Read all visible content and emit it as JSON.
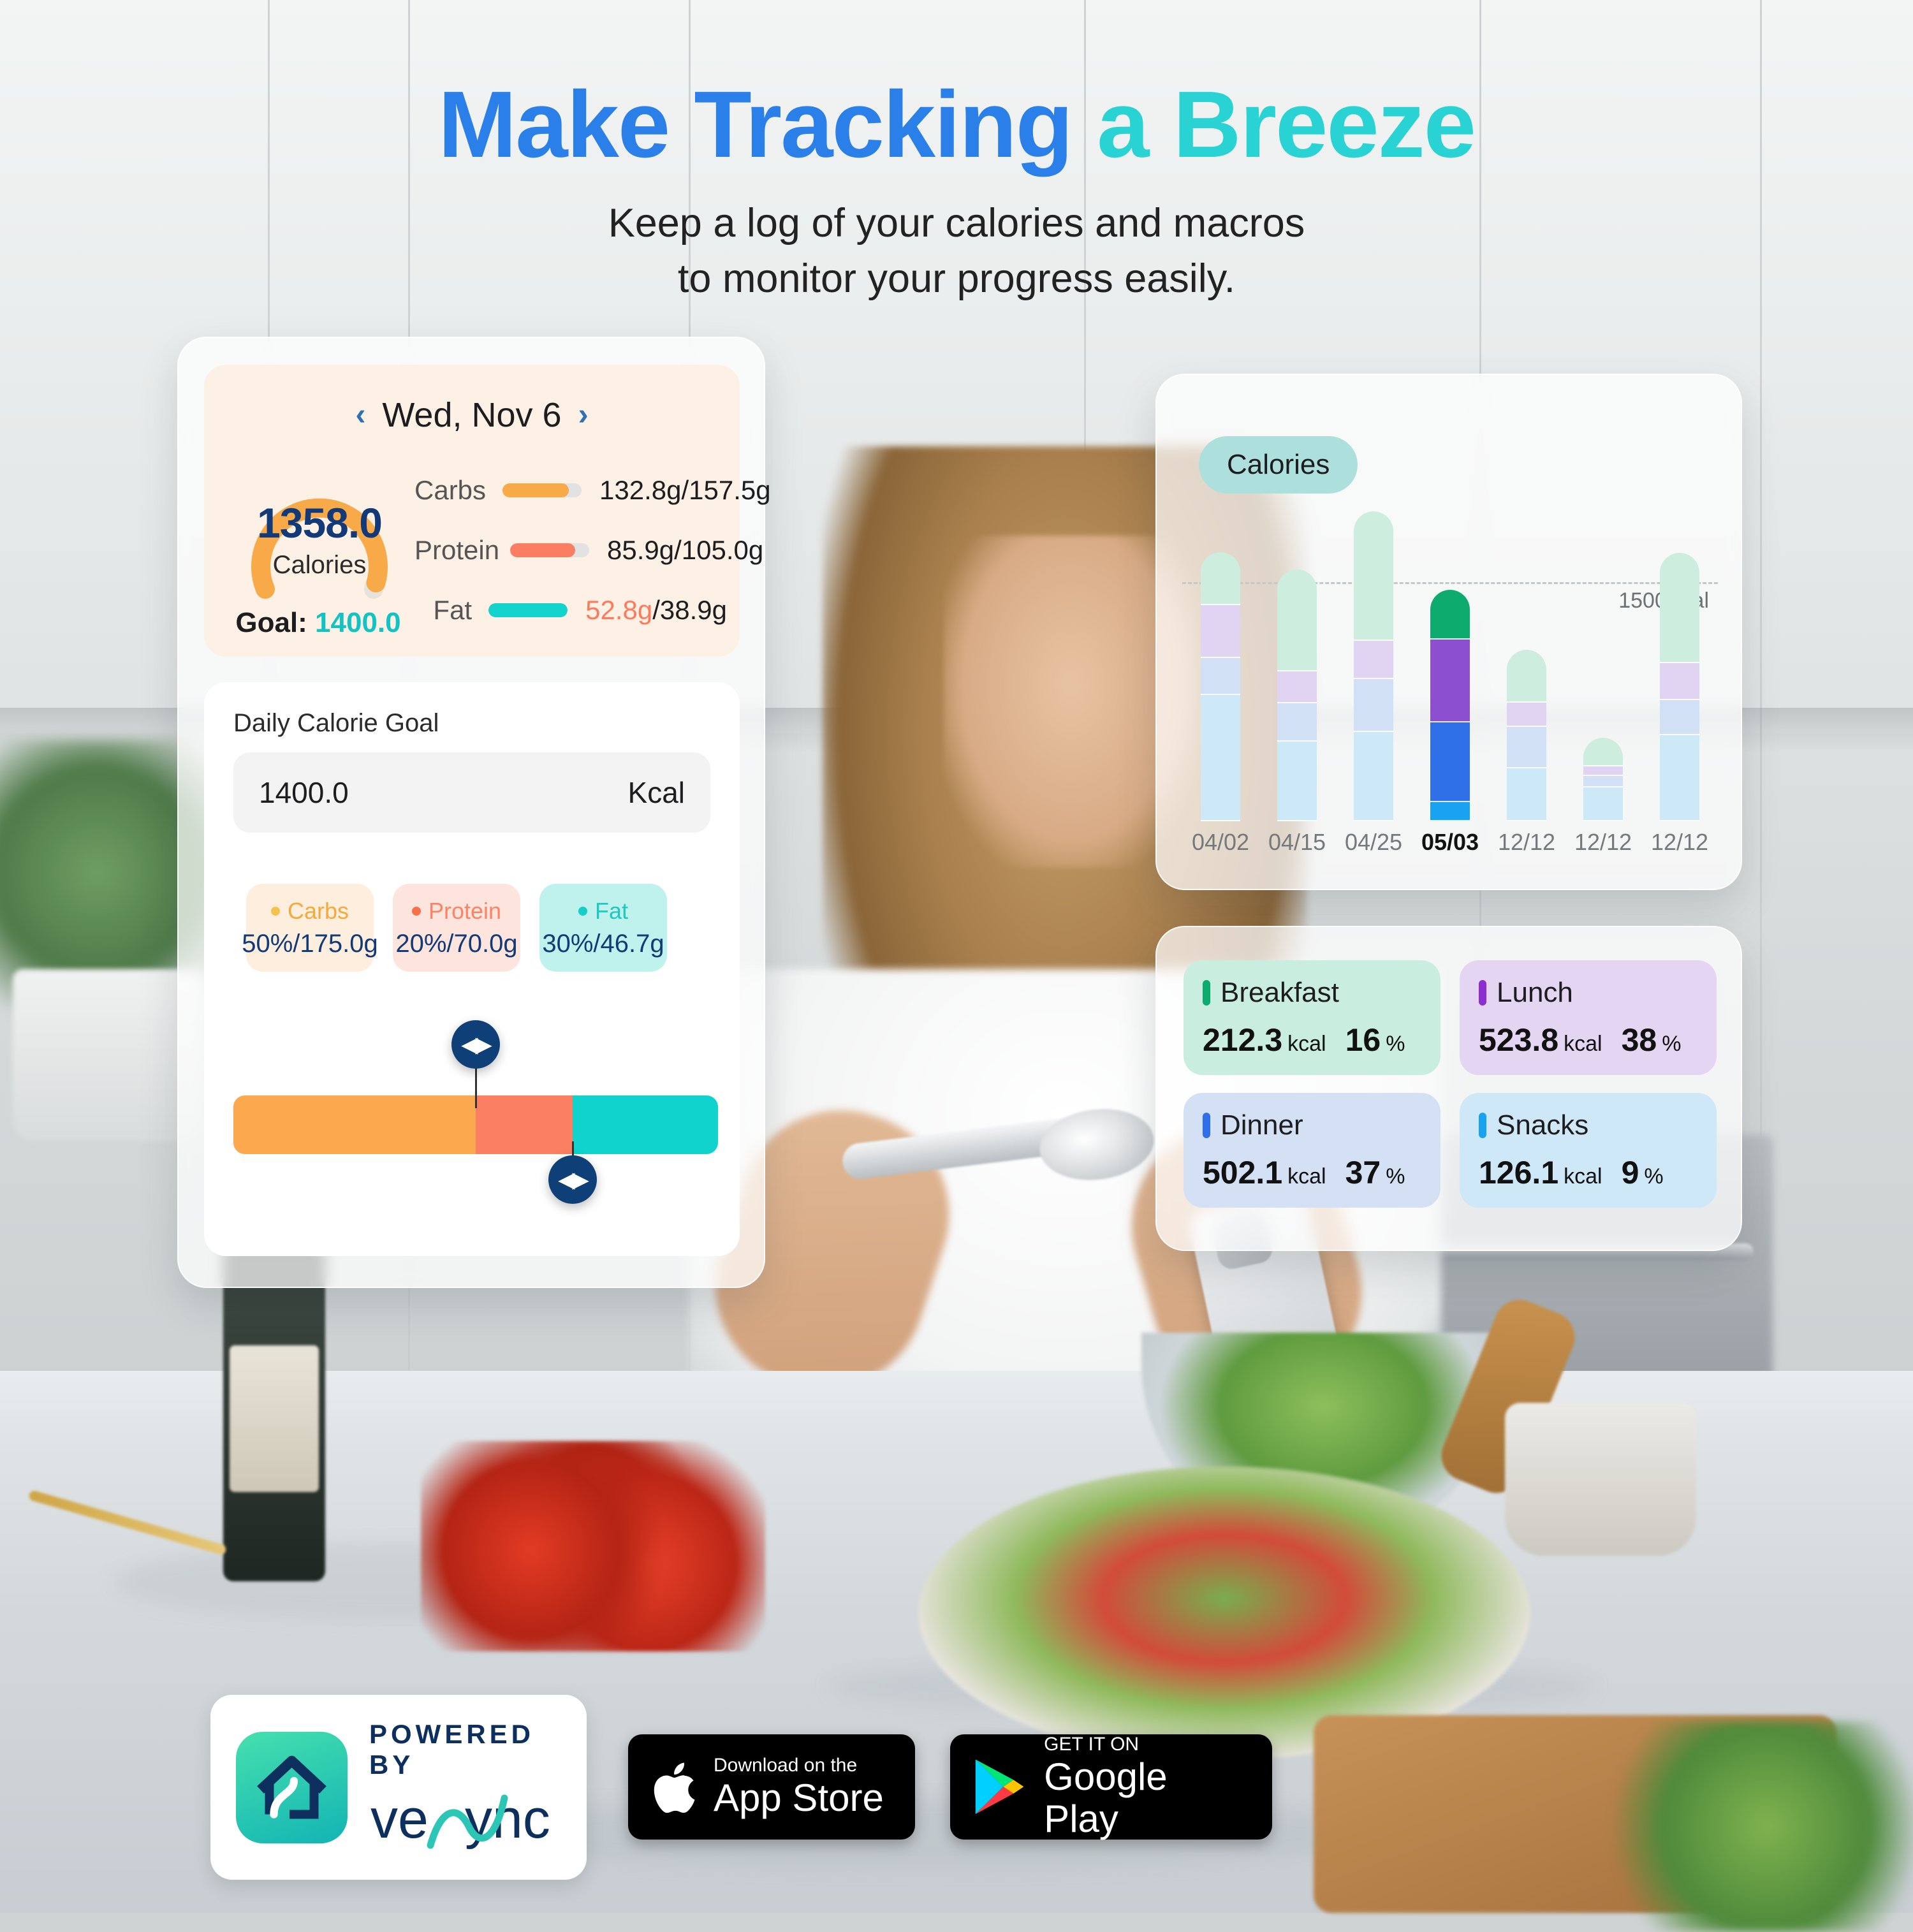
{
  "headline": {
    "title_part1": "Make Tracking ",
    "title_part2": "a Breeze",
    "sub_line1": "Keep a log of your calories and macros",
    "sub_line2": "to monitor your progress easily.",
    "color_part1": "#2b7fe8",
    "color_part2": "#2ad3d3"
  },
  "summary": {
    "prev_arrow": "‹",
    "next_arrow": "›",
    "date": "Wed, Nov 6",
    "calories_value": "1358.0",
    "calories_label": "Calories",
    "goal_prefix": "Goal: ",
    "goal_value": "1400.0",
    "gauge_percent": 97,
    "macros": [
      {
        "name": "Carbs",
        "value": "132.8g/157.5g",
        "color": "#f8a948",
        "fill_pct": 84,
        "over": false,
        "over_text": ""
      },
      {
        "name": "Protein",
        "value": "85.9g/105.0g",
        "color": "#fa7f62",
        "fill_pct": 82,
        "over": false,
        "over_text": ""
      },
      {
        "name": "Fat",
        "value": "/38.9g",
        "color": "#12d4cc",
        "fill_pct": 100,
        "over": true,
        "over_text": "52.8g"
      }
    ]
  },
  "daily_goal": {
    "title": "Daily Calorie Goal",
    "input_value": "1400.0",
    "input_unit": "Kcal",
    "macro_cards": [
      {
        "name": "Carbs",
        "value": "50%/175.0g",
        "bg": "#fdeedd",
        "fg": "#f6a93b",
        "dot": "#f6c24b"
      },
      {
        "name": "Protein",
        "value": "20%/70.0g",
        "bg": "#fde4dc",
        "fg": "#fa8465",
        "dot": "#fa7049"
      },
      {
        "name": "Fat",
        "value": "30%/46.7g",
        "bg": "#bff2ec",
        "fg": "#1fc9c0",
        "dot": "#14cfc6"
      }
    ],
    "slider": {
      "segments": [
        {
          "name": "Carbs",
          "pct": 50,
          "color": "#fba84f"
        },
        {
          "name": "Protein",
          "pct": 20,
          "color": "#fb7f62"
        },
        {
          "name": "Fat",
          "pct": 30,
          "color": "#0fd3cc"
        }
      ],
      "knob_glyph": "◀▶",
      "knob1_pct": 50,
      "knob2_pct": 70
    }
  },
  "chart_data": {
    "type": "bar",
    "title": "Calories",
    "xlabel": "",
    "ylabel": "",
    "ylim": [
      0,
      2000
    ],
    "grid": false,
    "legend_position": "none",
    "goal_line": {
      "value": 1500,
      "label": "1500Kcal",
      "style": "dashed"
    },
    "categories": [
      "04/02",
      "04/15",
      "04/25",
      "05/03",
      "12/12",
      "12/12",
      "12/12"
    ],
    "active_category": "05/03",
    "series": [
      {
        "name": "Breakfast",
        "color_active": "#0eab6e",
        "color_dim": "#cdeede",
        "values": [
          330,
          640,
          810,
          310,
          330,
          180,
          690
        ]
      },
      {
        "name": "Lunch",
        "color_active": "#8b4fd0",
        "color_dim": "#e0d4f2",
        "values": [
          330,
          200,
          240,
          520,
          150,
          60,
          230
        ]
      },
      {
        "name": "Dinner",
        "color_active": "#2f6fe8",
        "color_dim": "#d2e0f5",
        "values": [
          230,
          240,
          330,
          500,
          260,
          70,
          220
        ]
      },
      {
        "name": "Snacks",
        "color_active": "#19a2ef",
        "color_dim": "#cde9f8",
        "values": [
          790,
          500,
          560,
          120,
          330,
          210,
          540
        ]
      }
    ],
    "totals": [
      1680,
      1580,
      1940,
      1450,
      1070,
      520,
      1680
    ]
  },
  "meals": [
    {
      "name": "Breakfast",
      "kcal": "212.3",
      "kcal_unit": "kcal",
      "pct": "16",
      "pct_unit": "%",
      "bg": "#c9eedf",
      "tick": "#0eab6e"
    },
    {
      "name": "Lunch",
      "kcal": "523.8",
      "kcal_unit": "kcal",
      "pct": "38",
      "pct_unit": "%",
      "bg": "#e4d5f2",
      "tick": "#8b2fd0"
    },
    {
      "name": "Dinner",
      "kcal": "502.1",
      "kcal_unit": "kcal",
      "pct": "37",
      "pct_unit": "%",
      "bg": "#d4e0f4",
      "tick": "#2f6fe8"
    },
    {
      "name": "Snacks",
      "kcal": "126.1",
      "kcal_unit": "kcal",
      "pct": "9",
      "pct_unit": "%",
      "bg": "#cfe8f8",
      "tick": "#19a2ef"
    }
  ],
  "badges": {
    "powered_by": "POWERED BY",
    "vesync_name": "vesync",
    "appstore_small": "Download on the",
    "appstore_big": "App Store",
    "googleplay_small": "GET IT ON",
    "googleplay_big": "Google Play"
  }
}
